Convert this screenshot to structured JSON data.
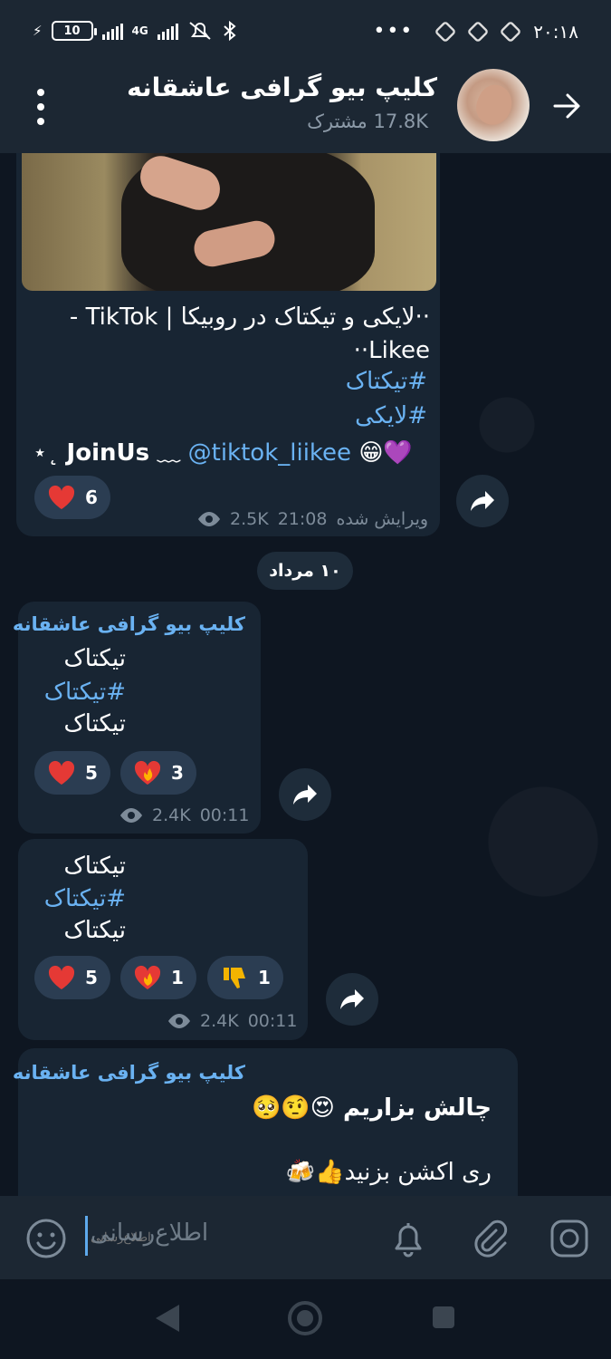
{
  "status_bar": {
    "battery": "10",
    "network": "4G",
    "time": "۲۰:۱۸",
    "more": "•••"
  },
  "header": {
    "title": "کلیپ بیو گرافی عاشقانه",
    "subscribers": "17.8K مشترک"
  },
  "messages": [
    {
      "caption_line1": "··لایکی و تیکتاک در روبیکا | TikTok -",
      "caption_line2": "Likee··",
      "hashtag1": "#تیکتاک",
      "hashtag2": "#لایکی",
      "join_line": "💜😁 @tiktok_liikee ﹏ JoinUs ˛⋆",
      "reactions": [
        {
          "emoji": "heart-red",
          "count": "6"
        }
      ],
      "edited_label": "ویرایش شده",
      "time": "21:08",
      "views": "2.5K"
    },
    {
      "sender": "کلیپ بیو گرافی عاشقانه",
      "line1": "تیکتاک",
      "hashtag": "#تیکتاک",
      "line3": "تیکتاک",
      "reactions": [
        {
          "emoji": "heart-red",
          "count": "5"
        },
        {
          "emoji": "heart-fire",
          "count": "3"
        }
      ],
      "time": "00:11",
      "views": "2.4K"
    },
    {
      "line1": "تیکتاک",
      "hashtag": "#تیکتاک",
      "line3": "تیکتاک",
      "reactions": [
        {
          "emoji": "heart-red",
          "count": "5"
        },
        {
          "emoji": "heart-fire",
          "count": "1"
        },
        {
          "emoji": "thumbs-down",
          "count": "1"
        }
      ],
      "time": "00:11",
      "views": "2.4K"
    },
    {
      "sender": "کلیپ بیو گرافی عاشقانه",
      "line1": "چالش بزاریم 😍🤨🥺",
      "line2": "ری اکشن بزنید👍🍻"
    }
  ],
  "date_separator": "۱۰ مرداد",
  "input": {
    "placeholder": "اطلاع‌رسانی"
  },
  "colors": {
    "background": "#0e1621",
    "bar": "#1c2733",
    "bubble": "#182533",
    "accent": "#6ab2f2",
    "reaction_bg": "#2b3d52"
  }
}
